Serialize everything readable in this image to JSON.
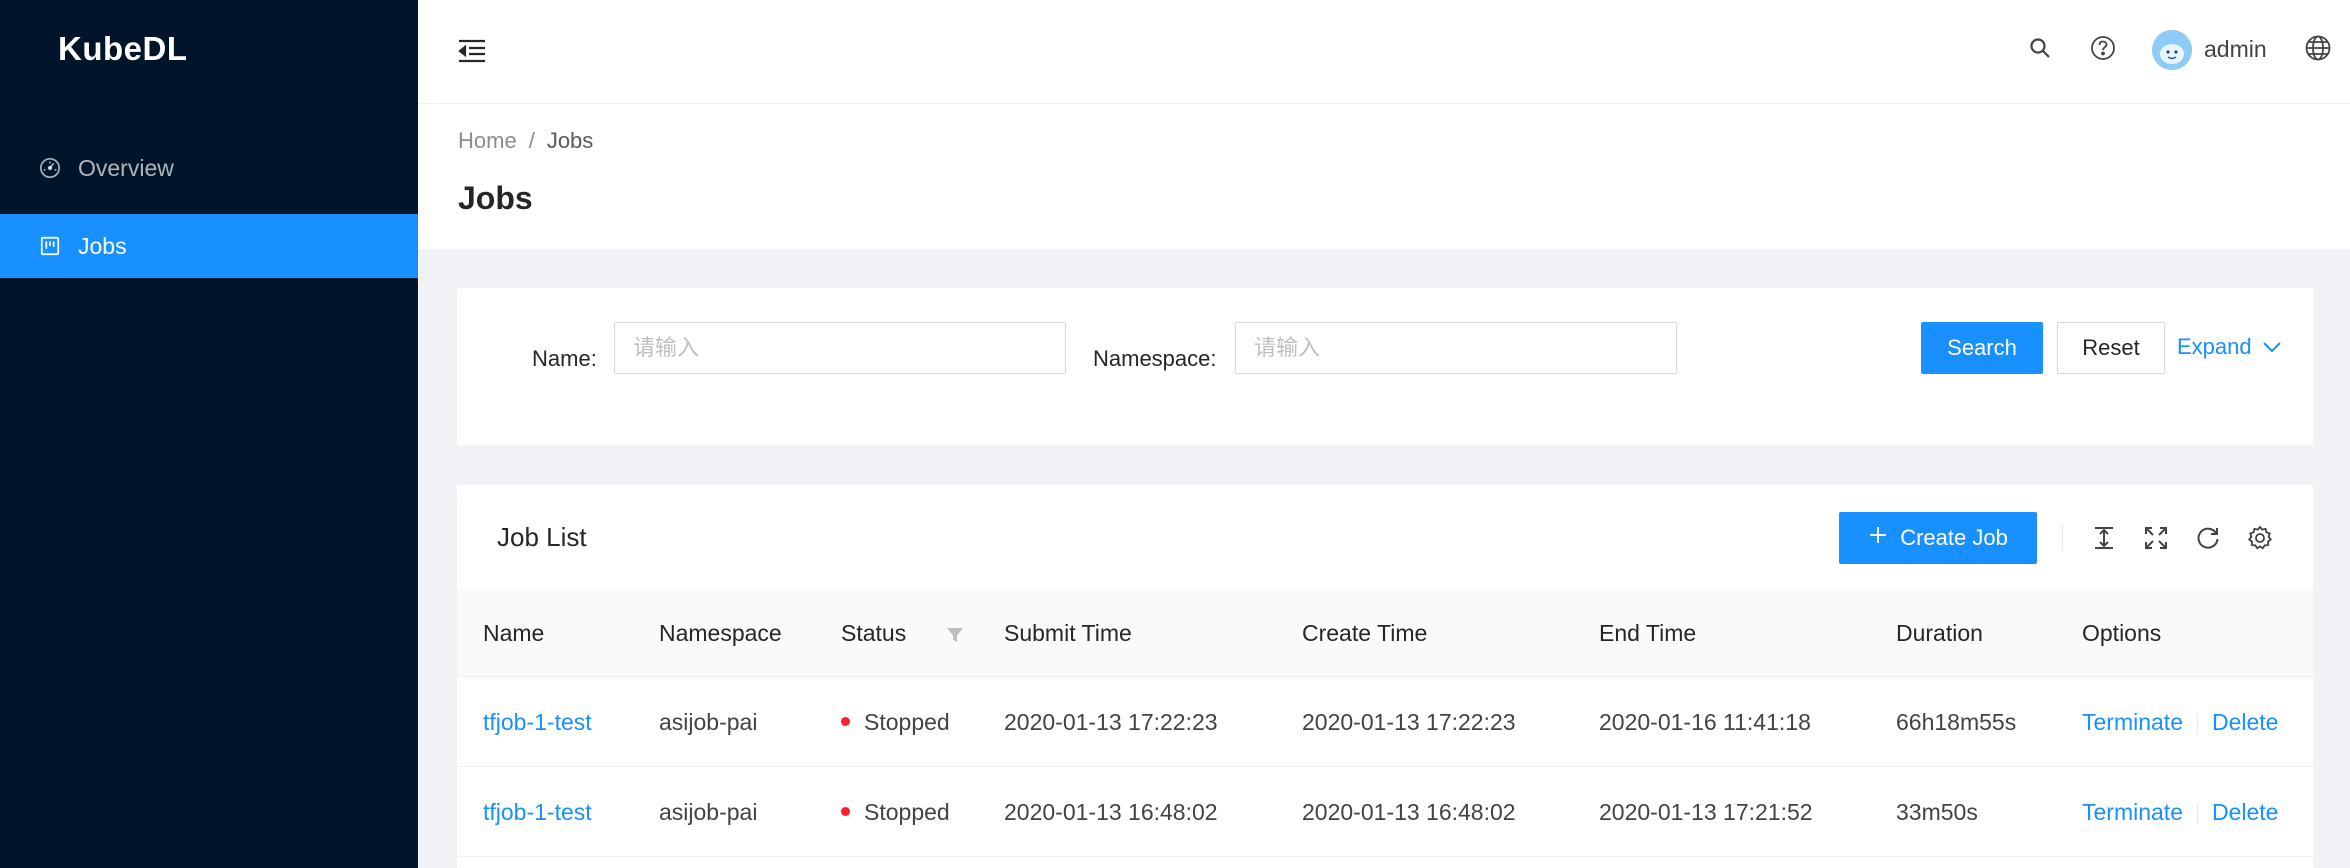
{
  "app": {
    "logo": "KubeDL"
  },
  "sidebar": {
    "items": [
      {
        "label": "Overview",
        "icon": "dashboard-icon",
        "active": false
      },
      {
        "label": "Jobs",
        "icon": "project-icon",
        "active": true
      }
    ]
  },
  "header": {
    "user": "admin",
    "icons": [
      "menu-fold-icon",
      "search-icon",
      "question-circle-icon",
      "avatar",
      "global-icon"
    ]
  },
  "breadcrumb": {
    "home": "Home",
    "separator": "/",
    "current": "Jobs"
  },
  "page": {
    "title": "Jobs"
  },
  "search": {
    "name_label": "Name",
    "name_placeholder": "请输入",
    "namespace_label": "Namespace",
    "namespace_placeholder": "请输入",
    "search_button": "Search",
    "reset_button": "Reset",
    "expand_link": "Expand"
  },
  "table": {
    "title": "Job List",
    "create_button": "Create Job",
    "columns": [
      "Name",
      "Namespace",
      "Status",
      "Submit Time",
      "Create Time",
      "End Time",
      "Duration",
      "Options"
    ],
    "rows": [
      {
        "name": "tfjob-1-test",
        "namespace": "asijob-pai",
        "status": "Stopped",
        "submit_time": "2020-01-13 17:22:23",
        "create_time": "2020-01-13 17:22:23",
        "end_time": "2020-01-16 11:41:18",
        "duration": "66h18m55s",
        "terminate": "Terminate",
        "delete": "Delete"
      },
      {
        "name": "tfjob-1-test",
        "namespace": "asijob-pai",
        "status": "Stopped",
        "submit_time": "2020-01-13 16:48:02",
        "create_time": "2020-01-13 16:48:02",
        "end_time": "2020-01-13 17:21:52",
        "duration": "33m50s",
        "terminate": "Terminate",
        "delete": "Delete"
      }
    ]
  },
  "colors": {
    "sidebar_bg": "#001529",
    "primary": "#1890ff",
    "status_stopped": "#f5222d"
  }
}
